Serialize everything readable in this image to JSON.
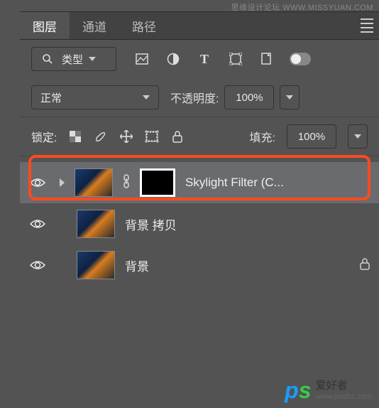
{
  "watermarks": {
    "top": "思缘设计论坛 WWW.MISSYUAN.COM",
    "bottom_cn": "爱好者",
    "bottom_url": "www.psahz.com"
  },
  "tabs": {
    "layers": "图层",
    "channels": "通道",
    "paths": "路径"
  },
  "filter": {
    "type_label": "类型"
  },
  "blend": {
    "mode": "正常",
    "opacity_label": "不透明度:",
    "opacity_value": "100%"
  },
  "lock": {
    "label": "锁定:",
    "fill_label": "填充:",
    "fill_value": "100%"
  },
  "layers": [
    {
      "name": "Skylight Filter (C..."
    },
    {
      "name": "背景 拷贝"
    },
    {
      "name": "背景"
    }
  ]
}
